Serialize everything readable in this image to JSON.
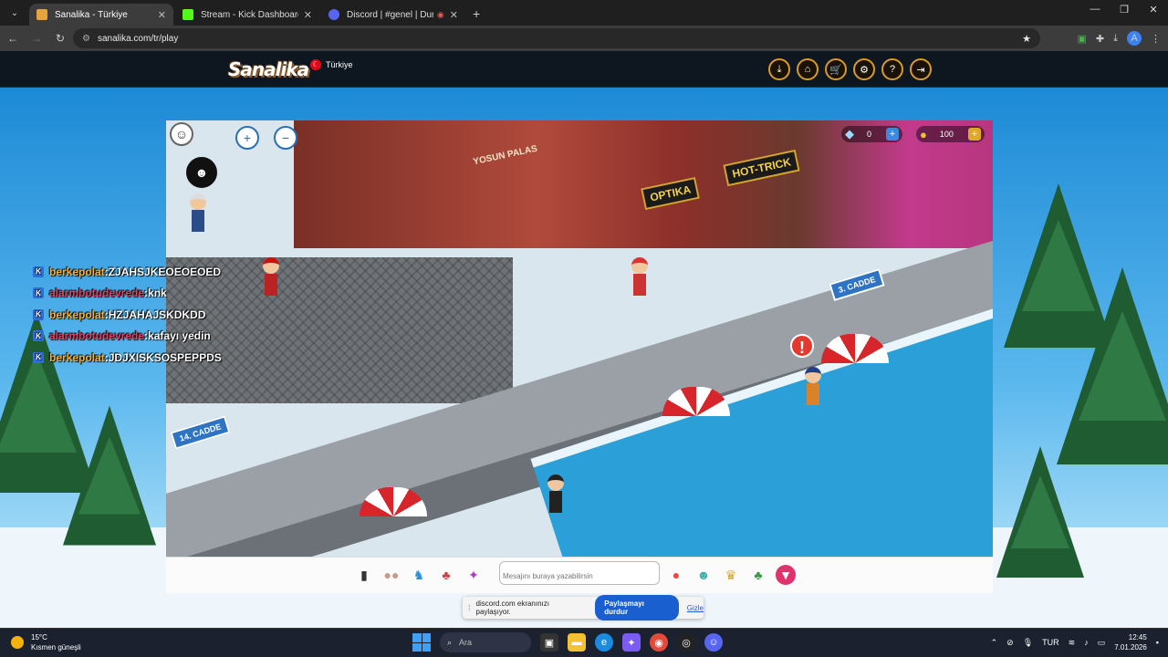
{
  "browser": {
    "tabs": [
      {
        "title": "Sanalika - Türkiye",
        "active": true,
        "fav_color": "#e8a33c"
      },
      {
        "title": "Stream - Kick Dashboard",
        "active": false,
        "fav_color": "#53fc18"
      },
      {
        "title": "Discord | #genel | Durum B...",
        "active": false,
        "fav_color": "#5865f2"
      }
    ],
    "url": "sanalika.com/tr/play"
  },
  "site": {
    "logo": "Sanalika",
    "country": "Türkiye",
    "header_icons": [
      "download-icon",
      "home-icon",
      "cart-icon",
      "settings-icon",
      "help-icon",
      "logout-icon"
    ]
  },
  "game": {
    "diamonds": "0",
    "coins": "100",
    "street_labels": {
      "a": "3. CADDE",
      "b": "14. CADDE"
    },
    "building_labels": {
      "optika": "OPTIKA",
      "hot": "HOT-TRICK",
      "palas": "YOSUN PALAS"
    }
  },
  "chat": [
    {
      "user": "berkepolat",
      "sep": " : ",
      "msg": "ZJAHSJKEOEOEOED",
      "color": "user1"
    },
    {
      "user": "alarmbotudevrede",
      "sep": " : ",
      "msg": "knk",
      "color": "user2"
    },
    {
      "user": "berkepolat",
      "sep": " : ",
      "msg": "HZJAHAJSKDKDD",
      "color": "user1"
    },
    {
      "user": "alarmbotudevrede",
      "sep": " : ",
      "msg": "kafayı yedin",
      "color": "user2"
    },
    {
      "user": "berkepolat",
      "sep": " : ",
      "msg": "JDJXISKSOSPEPPDS",
      "color": "user1"
    }
  ],
  "gamebar": {
    "placeholder": "Mesajını buraya yazabilirsin"
  },
  "sharebar": {
    "text": "discord.com ekranınızı paylaşıyor.",
    "stop": "Paylaşmayı durdur",
    "hide": "Gizle"
  },
  "taskbar": {
    "temp": "15°C",
    "weather": "Kısmen güneşli",
    "search": "Ara",
    "lang": "TUR",
    "time": "12:45",
    "date": "7.01.2026"
  }
}
